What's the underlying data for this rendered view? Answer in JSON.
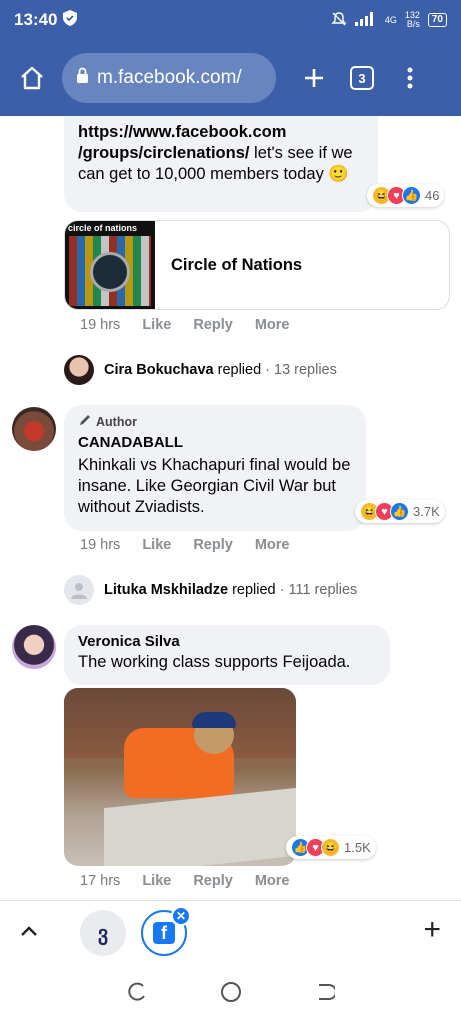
{
  "status": {
    "time": "13:40",
    "net_speed": "132",
    "net_unit": "B/s",
    "net_type": "4G",
    "battery": "70"
  },
  "browser": {
    "url": "m.facebook.com/",
    "tab_count": "3"
  },
  "colors": {
    "brand": "#3b5fa8",
    "bubble": "#f0f2f5",
    "link_blue": "#1877f2"
  },
  "comments": [
    {
      "text_link": "https://www.facebook.com /groups/circlenations/",
      "text_rest": " let's see if we can get to 10,000 members today 🙂",
      "reaction_count": "46",
      "link_card_title": "Circle of Nations",
      "thumb_label": "circle of nations",
      "time": "19 hrs",
      "like": "Like",
      "reply": "Reply",
      "more": "More",
      "replied_name": "Cira Bokuchava",
      "replied_label": "replied",
      "replied_count": "13 replies"
    },
    {
      "badge": "Author",
      "author": "CANADABALL",
      "text": "Khinkali vs Khachapuri final would be insane. Like Georgian Civil War but without Zviadists.",
      "reaction_count": "3.7K",
      "time": "19 hrs",
      "like": "Like",
      "reply": "Reply",
      "more": "More",
      "replied_name": "Lituka Mskhiladze",
      "replied_label": "replied",
      "replied_count": "111 replies"
    },
    {
      "author": "Veronica Silva",
      "text": "The working class supports Feijoada.",
      "reaction_count": "1.5K",
      "time": "17 hrs",
      "like": "Like",
      "reply": "Reply",
      "more": "More"
    }
  ],
  "bottom": {
    "add": "+"
  }
}
